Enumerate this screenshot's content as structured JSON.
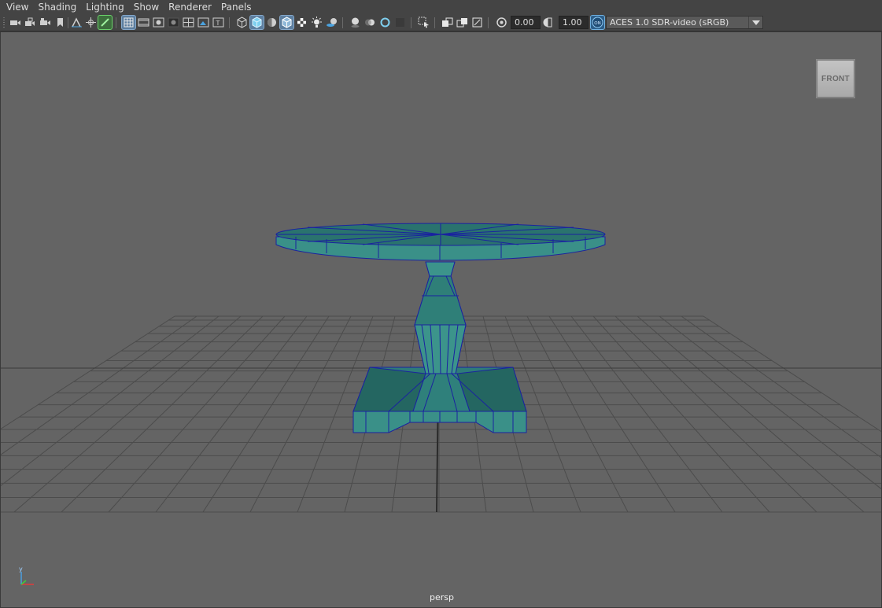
{
  "menu": {
    "items": [
      "View",
      "Shading",
      "Lighting",
      "Show",
      "Renderer",
      "Panels"
    ]
  },
  "toolbar": {
    "exposure_value": "0.00",
    "gamma_value": "1.00",
    "color_space": "ACES 1.0 SDR-video (sRGB)",
    "color_management_badge": "ON"
  },
  "viewport": {
    "camera_name": "persp",
    "view_cube_label": "FRONT",
    "axis_y": "y",
    "background_color": "#646464",
    "grid_color": "#4a4a4a",
    "mesh_color": "#3a8f86",
    "wire_color": "#1a22a0"
  }
}
